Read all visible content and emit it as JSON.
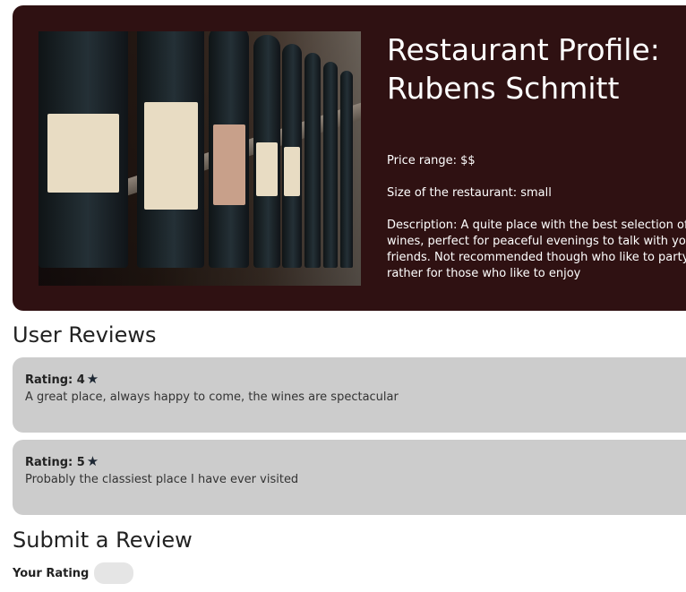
{
  "restaurant": {
    "title": "Restaurant Profile: Rubens Schmitt",
    "price_range": "Price range: $$",
    "size": "Size of the restaurant: small",
    "description": "Description: A quite place with the best selection of wines, perfect for peaceful evenings to talk with your friends. Not recommended though who like to party but rather for those who like to enjoy"
  },
  "reviews": {
    "heading": "User Reviews",
    "items": [
      {
        "rating_label": "Rating: 4",
        "text": "A great place, always happy to come, the wines are spectacular"
      },
      {
        "rating_label": "Rating: 5",
        "text": "Probably the classiest place I have ever visited"
      }
    ],
    "star_icon": "star-icon"
  },
  "submit": {
    "heading": "Submit a Review",
    "rating_label": "Your Rating"
  }
}
